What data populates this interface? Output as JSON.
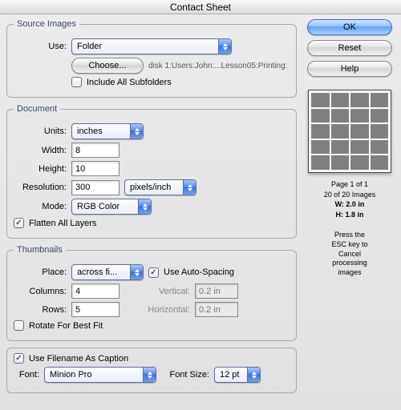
{
  "title": "Contact Sheet",
  "buttons": {
    "ok": "OK",
    "reset": "Reset",
    "help": "Help"
  },
  "source": {
    "legend": "Source Images",
    "use_label": "Use:",
    "use_value": "Folder",
    "choose_label": "Choose...",
    "path": "disk 1:Users:John:...Lesson05:Printing:",
    "include_label": "Include All Subfolders"
  },
  "document": {
    "legend": "Document",
    "units_label": "Units:",
    "units_value": "inches",
    "width_label": "Width:",
    "width_value": "8",
    "height_label": "Height:",
    "height_value": "10",
    "resolution_label": "Resolution:",
    "resolution_value": "300",
    "resolution_units": "pixels/inch",
    "mode_label": "Mode:",
    "mode_value": "RGB Color",
    "flatten_label": "Flatten All Layers"
  },
  "thumbs": {
    "legend": "Thumbnails",
    "place_label": "Place:",
    "place_value": "across fi...",
    "auto_label": "Use Auto-Spacing",
    "columns_label": "Columns:",
    "columns_value": "4",
    "rows_label": "Rows:",
    "rows_value": "5",
    "vertical_label": "Vertical:",
    "vertical_value": "0.2 in",
    "horizontal_label": "Horizontal:",
    "horizontal_value": "0.2 in",
    "rotate_label": "Rotate For Best Fit"
  },
  "caption": {
    "use_label": "Use Filename As Caption",
    "font_label": "Font:",
    "font_value": "Minion Pro",
    "size_label": "Font Size:",
    "size_value": "12 pt"
  },
  "info": {
    "page": "Page 1 of 1",
    "count": "20 of 20 Images",
    "w": "W: 2.0 in",
    "h": "H: 1.8 in"
  },
  "hint": "Press the\nESC key to\nCancel\nprocessing\nimages"
}
